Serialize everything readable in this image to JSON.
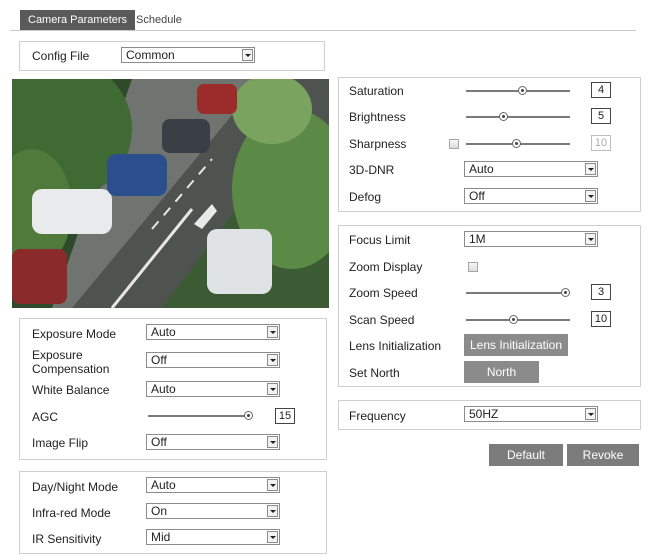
{
  "tabs": [
    "Camera Parameters",
    "Schedule"
  ],
  "config_file": {
    "label": "Config File",
    "value": "Common"
  },
  "image": {
    "saturation": {
      "label": "Saturation",
      "value": "4",
      "level": 0.55
    },
    "brightness": {
      "label": "Brightness",
      "value": "5",
      "level": 0.35
    },
    "sharpness": {
      "label": "Sharpness",
      "value": "10",
      "level": 0.48
    },
    "dnr": {
      "label": "3D-DNR",
      "value": "Auto"
    },
    "defog": {
      "label": "Defog",
      "value": "Off"
    }
  },
  "focus": {
    "focus_limit": {
      "label": "Focus Limit",
      "value": "1M"
    },
    "zoom_display": {
      "label": "Zoom Display"
    },
    "zoom_speed": {
      "label": "Zoom Speed",
      "value": "3",
      "level": 1.0
    },
    "scan_speed": {
      "label": "Scan Speed",
      "value": "10",
      "level": 0.45
    },
    "lens_init": {
      "label": "Lens Initialization",
      "button": "Lens Initialization"
    },
    "set_north": {
      "label": "Set North",
      "button": "North"
    }
  },
  "frequency": {
    "label": "Frequency",
    "value": "50HZ"
  },
  "buttons": {
    "default": "Default",
    "revoke": "Revoke"
  },
  "exposure": {
    "mode": {
      "label": "Exposure Mode",
      "value": "Auto"
    },
    "compensation": {
      "label": "Exposure Compensation",
      "value": "Off"
    },
    "white_balance": {
      "label": "White Balance",
      "value": "Auto"
    },
    "agc": {
      "label": "AGC",
      "value": "15",
      "level": 1.0
    },
    "flip": {
      "label": "Image Flip",
      "value": "Off"
    }
  },
  "daynight": {
    "mode": {
      "label": "Day/Night Mode",
      "value": "Auto"
    },
    "infrared": {
      "label": "Infra-red Mode",
      "value": "On"
    },
    "ir_sensitivity": {
      "label": "IR Sensitivity",
      "value": "Mid"
    }
  }
}
